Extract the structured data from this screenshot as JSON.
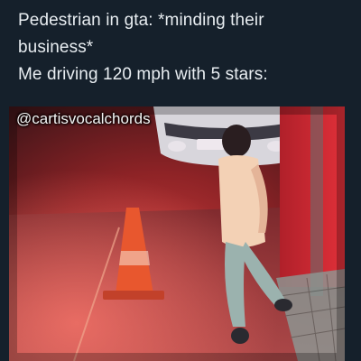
{
  "caption": {
    "line1": "Pedestrian in gta: *minding their",
    "line2": "business*",
    "line3": "Me driving 120 mph with 5 stars:"
  },
  "media": {
    "watermark": "@cartisvocalchords",
    "colors": {
      "background": "#15202b",
      "text": "#e8edf1",
      "red_glow": "#d82a2a",
      "cone": "#e8572e"
    }
  }
}
